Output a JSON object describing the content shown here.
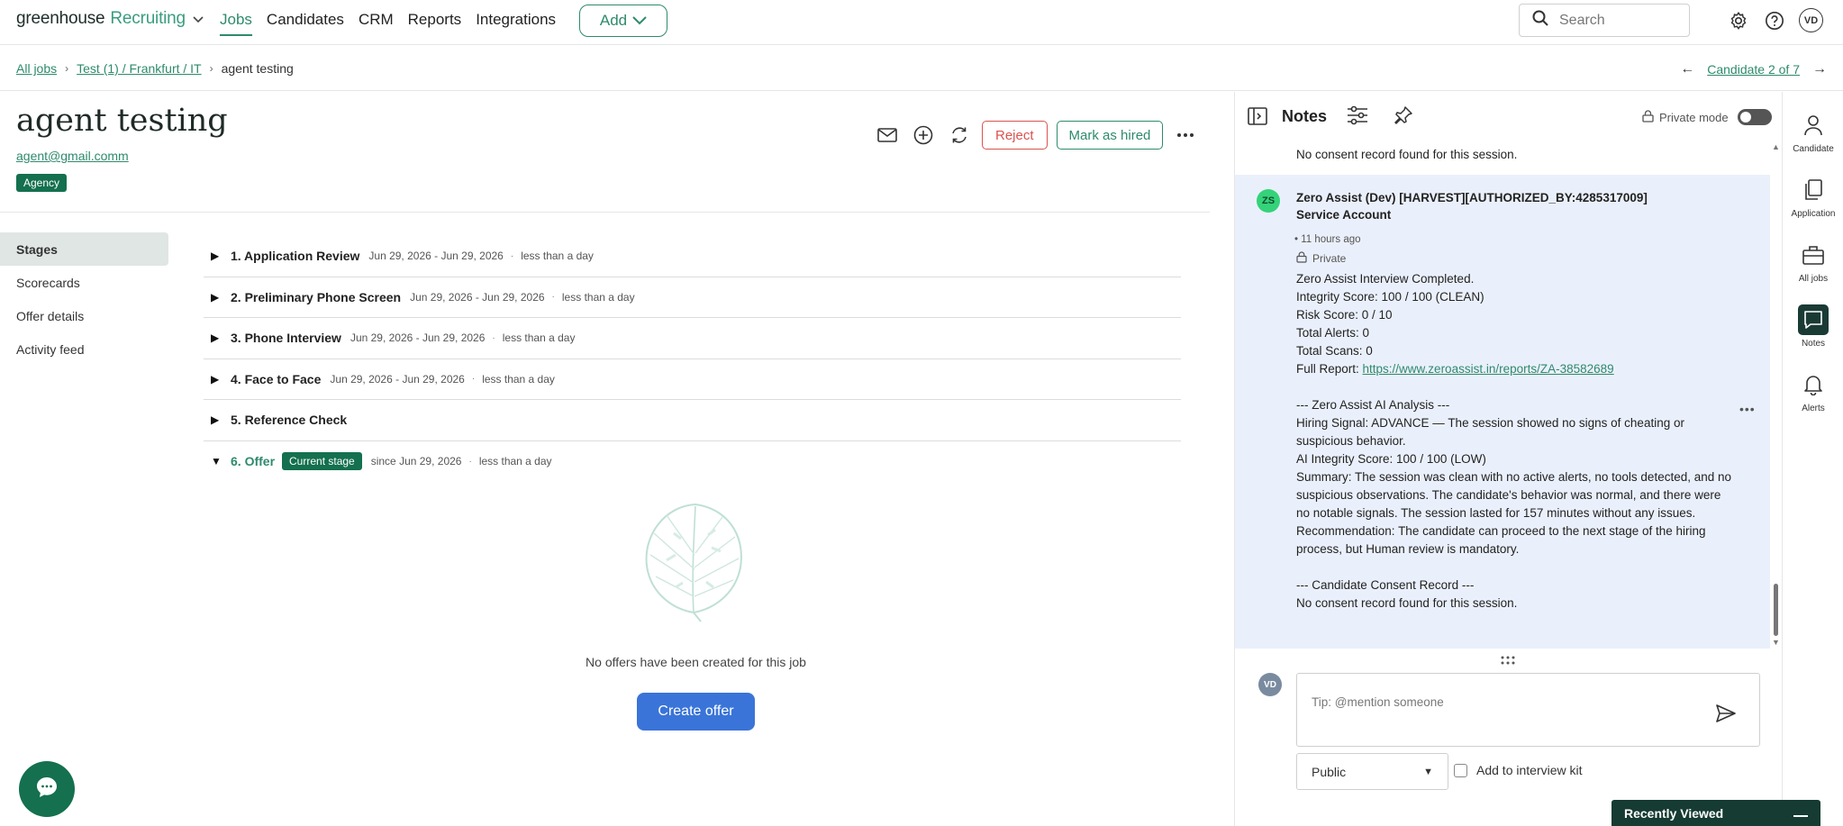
{
  "app": {
    "logo_brand": "greenhouse",
    "logo_product": "Recruiting"
  },
  "nav": {
    "links": [
      "Jobs",
      "Candidates",
      "CRM",
      "Reports",
      "Integrations"
    ],
    "add_label": "Add",
    "search_placeholder": "Search",
    "user_initials": "VD"
  },
  "breadcrumb": {
    "items": [
      "All jobs",
      "Test (1) / Frankfurt / IT",
      "agent testing"
    ],
    "candidate_position": "Candidate 2 of 7"
  },
  "candidate": {
    "name": "agent testing",
    "email": "agent@gmail.comm",
    "badge": "Agency"
  },
  "actions": {
    "reject_label": "Reject",
    "hired_label": "Mark as hired"
  },
  "left_tabs": [
    "Stages",
    "Scorecards",
    "Offer details",
    "Activity feed"
  ],
  "stages": [
    {
      "name": "1. Application Review",
      "dates": "Jun 29, 2026 - Jun 29, 2026",
      "duration": "less than a day"
    },
    {
      "name": "2. Preliminary Phone Screen",
      "dates": "Jun 29, 2026 - Jun 29, 2026",
      "duration": "less than a day"
    },
    {
      "name": "3. Phone Interview",
      "dates": "Jun 29, 2026 - Jun 29, 2026",
      "duration": "less than a day"
    },
    {
      "name": "4. Face to Face",
      "dates": "Jun 29, 2026 - Jun 29, 2026",
      "duration": "less than a day"
    },
    {
      "name": "5. Reference Check",
      "dates": "",
      "duration": ""
    },
    {
      "name": "6. Offer",
      "badge": "Current stage",
      "dates": "since Jun 29, 2026",
      "duration": "less than a day"
    }
  ],
  "offer": {
    "empty_text": "No offers have been created for this job",
    "create_label": "Create offer"
  },
  "notes": {
    "title": "Notes",
    "private_mode_label": "Private mode",
    "previous_line": "No consent record found for this session.",
    "note": {
      "avatar": "ZS",
      "author_line1": "Zero Assist (Dev) [HARVEST][AUTHORIZED_BY:4285317009]",
      "author_line2": "Service Account",
      "time": "11 hours ago",
      "visibility": "Private",
      "lines": [
        "Zero Assist Interview Completed.",
        "Integrity Score: 100 / 100 (CLEAN)",
        "Risk Score: 0 / 10",
        "Total Alerts: 0",
        "Total Scans: 0"
      ],
      "report_prefix": "Full Report: ",
      "report_link": "https://www.zeroassist.in/reports/ZA-38582689",
      "analysis_lines": [
        "--- Zero Assist AI Analysis ---",
        "Hiring Signal: ADVANCE — The session showed no signs of cheating or suspicious behavior.",
        "AI Integrity Score: 100 / 100 (LOW)",
        "Summary: The session was clean with no active alerts, no tools detected, and no suspicious observations. The candidate's behavior was normal, and there were no notable signals. The session lasted for 157 minutes without any issues.",
        "Recommendation: The candidate can proceed to the next stage of the hiring process, but Human review is mandatory."
      ],
      "consent_lines": [
        "--- Candidate Consent Record ---",
        "No consent record found for this session."
      ]
    },
    "compose_placeholder": "Tip: @mention someone",
    "compose_avatar": "VD",
    "visibility_select": "Public",
    "add_to_kit_label": "Add to interview kit"
  },
  "rail": [
    "Candidate",
    "Application",
    "All jobs",
    "Notes",
    "Alerts"
  ],
  "recently_viewed": "Recently Viewed"
}
